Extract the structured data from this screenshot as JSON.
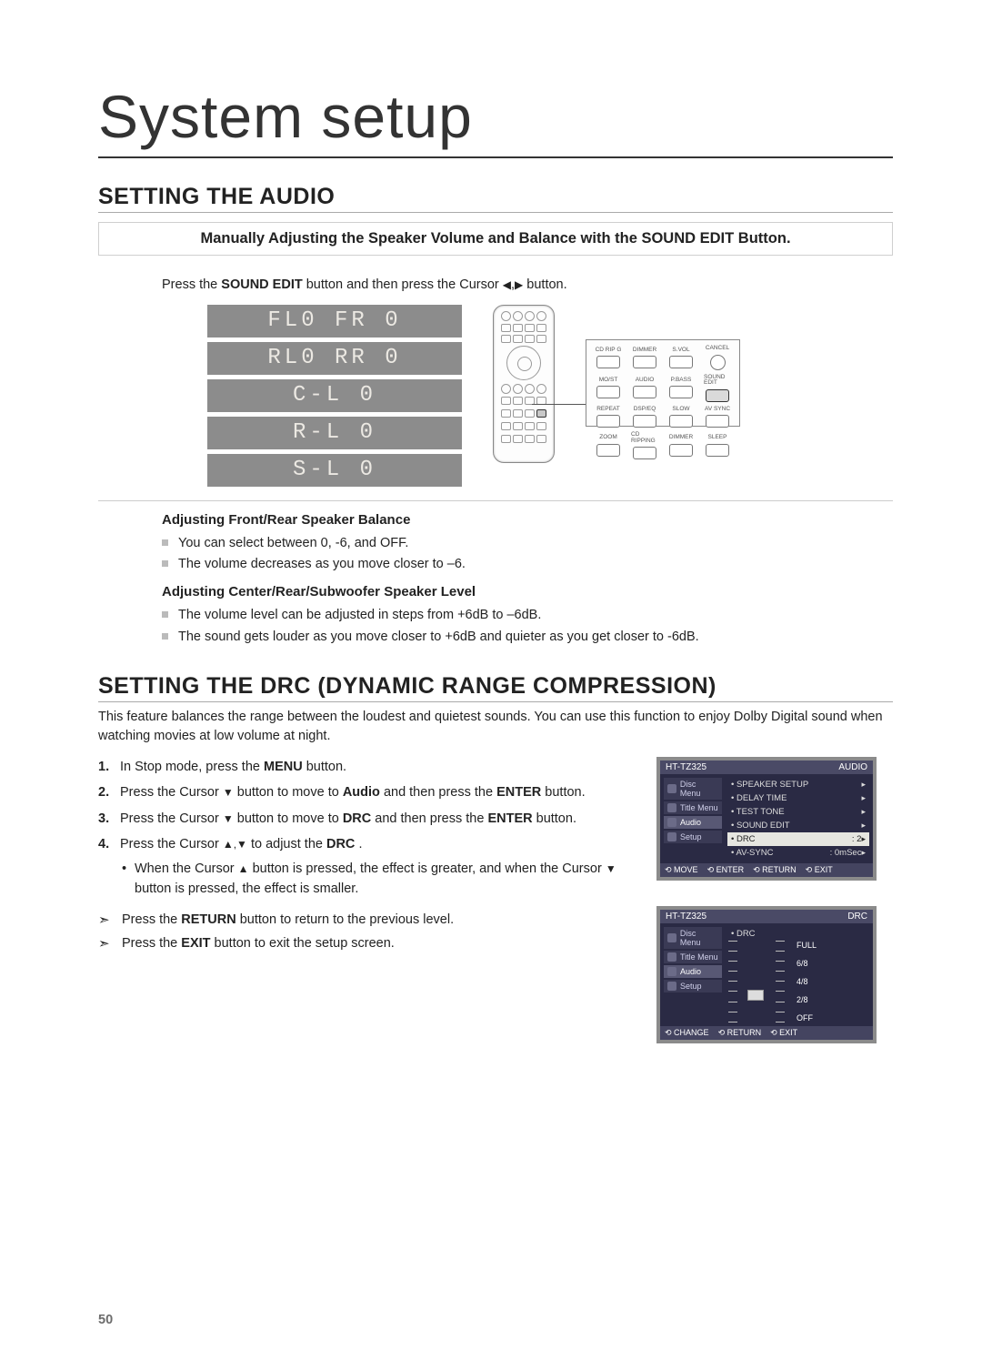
{
  "title": "System setup",
  "section1": {
    "heading": "SETTING THE AUDIO",
    "subtitle": "Manually Adjusting the Speaker Volume and Balance with the SOUND EDIT Button.",
    "instruction_pre": "Press the ",
    "instruction_bold": "SOUND EDIT",
    "instruction_mid": " button and then press the Cursor ",
    "instruction_suf": " button.",
    "displays": [
      "FL0 FR 0",
      "RL0 RR 0",
      "C-L   0",
      "R-L   0",
      "S-L   0"
    ],
    "remote_buttons": [
      {
        "label": "CD RIP G",
        "class": ""
      },
      {
        "label": "DIMMER",
        "class": ""
      },
      {
        "label": "S.VOL",
        "class": ""
      },
      {
        "label": "CANCEL",
        "class": "circle"
      },
      {
        "label": "MO/ST",
        "class": ""
      },
      {
        "label": "AUDIO",
        "class": ""
      },
      {
        "label": "P.BASS",
        "class": ""
      },
      {
        "label": "SOUND EDIT",
        "class": "highlight"
      },
      {
        "label": "REPEAT",
        "class": ""
      },
      {
        "label": "DSP/EQ",
        "class": ""
      },
      {
        "label": "SLOW",
        "class": ""
      },
      {
        "label": "AV SYNC",
        "class": ""
      },
      {
        "label": "ZOOM",
        "class": ""
      },
      {
        "label": "CD RIPPING",
        "class": ""
      },
      {
        "label": "DIMMER",
        "class": ""
      },
      {
        "label": "SLEEP",
        "class": ""
      }
    ],
    "sub1": "Adjusting Front/Rear Speaker Balance",
    "sub1_items": [
      "You can select between 0, -6, and OFF.",
      "The volume decreases as you move closer to –6."
    ],
    "sub2": "Adjusting Center/Rear/Subwoofer Speaker Level",
    "sub2_items": [
      "The volume level can be adjusted in steps from +6dB to –6dB.",
      "The sound gets louder as you move closer to +6dB and quieter as you get closer to -6dB."
    ]
  },
  "section2": {
    "heading": "SETTING THE DRC (DYNAMIC RANGE COMPRESSION)",
    "desc": "This feature balances the range between the loudest and quietest sounds. You can use this function to enjoy Dolby Digital sound when watching movies at low volume at night.",
    "step1_pre": "In Stop mode, press the ",
    "step1_b": "MENU",
    "step1_suf": " button.",
    "step2_pre": "Press the Cursor ",
    "step2_mid": " button to move to ",
    "step2_b1": "Audio",
    "step2_mid2": " and then press the ",
    "step2_b2": "ENTER",
    "step2_suf": " button.",
    "step3_pre": "Press the Cursor ",
    "step3_mid": " button to move to ",
    "step3_b1": "DRC",
    "step3_mid2": " and then press the ",
    "step3_b2": "ENTER",
    "step3_suf": " button.",
    "step4_pre": "Press the Cursor ",
    "step4_mid": " to adjust the ",
    "step4_b": "DRC",
    "step4_suf": ".",
    "step4_bullet_pre": "When the Cursor ",
    "step4_bullet_mid": " button is pressed, the effect is greater, and when the Cursor ",
    "step4_bullet_suf": " button is pressed, the effect is smaller.",
    "note1_pre": "Press the ",
    "note1_b": "RETURN",
    "note1_suf": " button to return to the previous level.",
    "note2_pre": "Press the ",
    "note2_b": "EXIT",
    "note2_suf": " button to exit the setup screen.",
    "osd1": {
      "top_left": "HT-TZ325",
      "top_right": "AUDIO",
      "side": [
        "Disc Menu",
        "Title Menu",
        "Audio",
        "Setup"
      ],
      "rows": [
        {
          "l": "• SPEAKER SETUP",
          "r": ""
        },
        {
          "l": "• DELAY TIME",
          "r": ""
        },
        {
          "l": "• TEST TONE",
          "r": ""
        },
        {
          "l": "• SOUND EDIT",
          "r": ""
        },
        {
          "l": "• DRC",
          "r": ": 2"
        },
        {
          "l": "• AV-SYNC",
          "r": ": 0mSec"
        }
      ],
      "foot": [
        "MOVE",
        "ENTER",
        "RETURN",
        "EXIT"
      ]
    },
    "osd2": {
      "top_left": "HT-TZ325",
      "top_right": "DRC",
      "side": [
        "Disc Menu",
        "Title Menu",
        "Audio",
        "Setup"
      ],
      "row_l": "• DRC",
      "labels": [
        "FULL",
        "6/8",
        "4/8",
        "2/8",
        "OFF"
      ],
      "foot": [
        "CHANGE",
        "RETURN",
        "EXIT"
      ]
    }
  },
  "arrows": {
    "left": "◀",
    "right": "▶",
    "up": "▲",
    "down": "▼",
    "updown": "▲,▼"
  },
  "page_number": "50"
}
